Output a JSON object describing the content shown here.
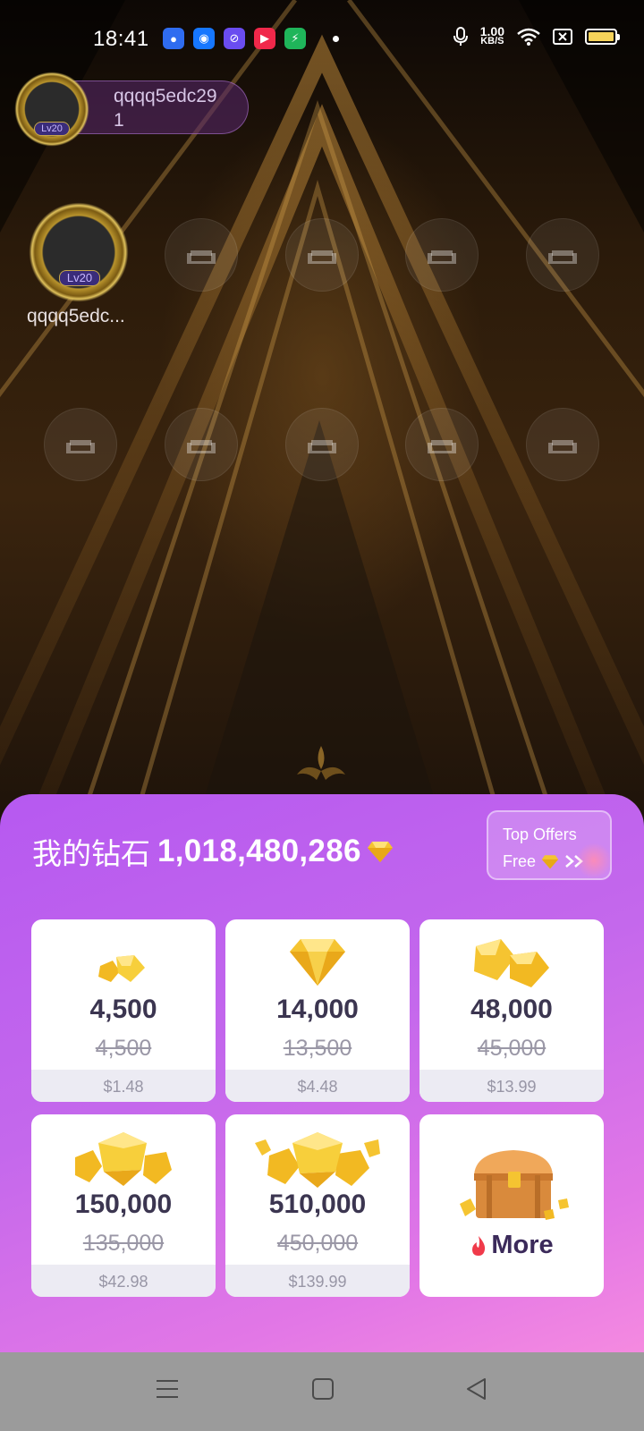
{
  "status_bar": {
    "time": "18:41",
    "net_speed_value": "1.00",
    "net_speed_unit": "KB/S",
    "app_icons": [
      {
        "name": "baidu-icon",
        "color": "#2f6cf0"
      },
      {
        "name": "browser-icon",
        "color": "#1677ff"
      },
      {
        "name": "privacy-icon",
        "color": "#6a4cf0"
      },
      {
        "name": "video-icon",
        "color": "#f0284a"
      },
      {
        "name": "shield-icon",
        "color": "#1fb55a"
      }
    ]
  },
  "host": {
    "name_line1": "qqqq5edc29",
    "name_line2": "1",
    "level": "Lv20"
  },
  "owner_seat": {
    "name": "qqqq5edc...",
    "level": "Lv20"
  },
  "seats": {
    "empty_icon": "sofa-icon",
    "rows": [
      [
        "sofa",
        "sofa",
        "sofa",
        "sofa"
      ],
      [
        "sofa",
        "sofa",
        "sofa",
        "sofa",
        "sofa"
      ]
    ]
  },
  "wallet": {
    "label": "我的钻石",
    "balance": "1,018,480,286",
    "top_offers_line1": "Top Offers",
    "top_offers_line2": "Free"
  },
  "packages": [
    {
      "amount": "4,500",
      "original": "4,500",
      "price": "$1.48",
      "art": "small"
    },
    {
      "amount": "14,000",
      "original": "13,500",
      "price": "$4.48",
      "art": "single"
    },
    {
      "amount": "48,000",
      "original": "45,000",
      "price": "$13.99",
      "art": "double"
    },
    {
      "amount": "150,000",
      "original": "135,000",
      "price": "$42.98",
      "art": "pile"
    },
    {
      "amount": "510,000",
      "original": "450,000",
      "price": "$139.99",
      "art": "big-pile"
    }
  ],
  "more": {
    "label": "More"
  },
  "colors": {
    "sheet_start": "#b659f0",
    "sheet_end": "#f58ae0",
    "gem_gold": "#f5c431",
    "amount_text": "#3b3550"
  }
}
